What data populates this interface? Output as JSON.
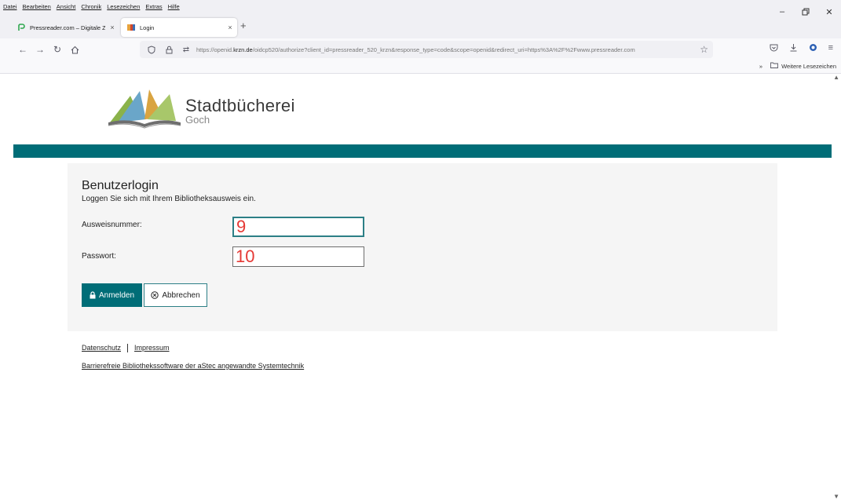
{
  "menubar": {
    "items": [
      "Datei",
      "Bearbeiten",
      "Ansicht",
      "Chronik",
      "Lesezeichen",
      "Extras",
      "Hilfe"
    ]
  },
  "tabs": [
    {
      "title": "Pressreader.com – Digitale Zeit",
      "close": "×",
      "icon": "pressreader-icon"
    },
    {
      "title": "Login",
      "close": "×",
      "icon": "library-favicon"
    }
  ],
  "new_tab": "+",
  "address_bar": {
    "url_prefix": "https://openid.",
    "url_domain": "krzn.de",
    "url_rest": "/oidcp520/authorize?client_id=pressreader_520_krzn&response_type=code&scope=openid&redirect_uri=https%3A%2F%2Fwww.pressreader.com"
  },
  "bookmarks": {
    "overflow": "»",
    "folder_label": "Weitere Lesezeichen"
  },
  "logo": {
    "name": "Stadtbücherei",
    "city": "Goch"
  },
  "colors": {
    "brand_teal": "#006d77",
    "input_value_red": "#e53935"
  },
  "login": {
    "title": "Benutzerlogin",
    "subtitle": "Loggen Sie sich mit Ihrem Bibliotheksausweis ein.",
    "card_label": "Ausweisnummer:",
    "card_value": "9",
    "password_label": "Passwort:",
    "password_value": "10",
    "submit_label": "Anmelden",
    "cancel_label": "Abbrechen"
  },
  "footer": {
    "privacy": "Datenschutz",
    "imprint": "Impressum",
    "software": "Barrierefreie Bibliothekssoftware der aStec angewandte Systemtechnik"
  }
}
